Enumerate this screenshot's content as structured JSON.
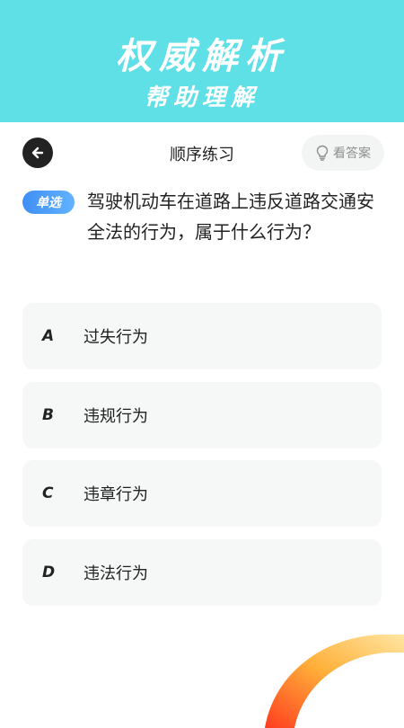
{
  "banner": {
    "title": "权威解析",
    "subtitle": "帮助理解"
  },
  "header": {
    "title": "顺序练习",
    "answer_button_label": "看答案"
  },
  "question": {
    "type_label": "单选",
    "text": "驾驶机动车在道路上违反道路交通安全法的行为，属于什么行为？"
  },
  "options": [
    {
      "letter": "A",
      "text": "过失行为"
    },
    {
      "letter": "B",
      "text": "违规行为"
    },
    {
      "letter": "C",
      "text": "违章行为"
    },
    {
      "letter": "D",
      "text": "违法行为"
    }
  ],
  "colors": {
    "banner_bg": "#5ee0e6",
    "badge_blue": "#3f8ff5",
    "back_button": "#222222"
  },
  "icons": {
    "back": "arrow-left-icon",
    "answer": "lightbulb-icon"
  }
}
